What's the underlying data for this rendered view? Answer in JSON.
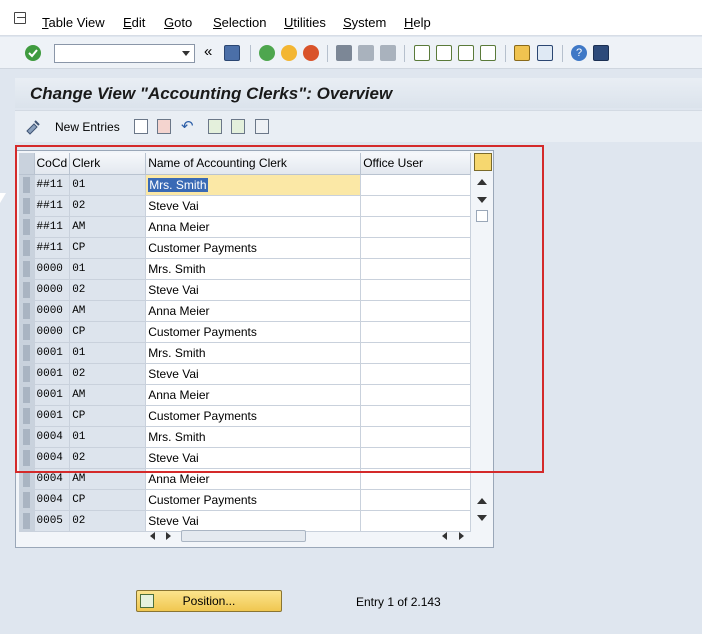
{
  "menubar": {
    "items": [
      "Table View",
      "Edit",
      "Goto",
      "Selection",
      "Utilities",
      "System",
      "Help"
    ]
  },
  "toolbar": {
    "command_field_value": "",
    "icons": [
      "enter-icon",
      "back-double-icon",
      "save-icon",
      "back-icon",
      "exit-icon",
      "cancel-icon",
      "print-icon",
      "find-icon",
      "find-next-icon",
      "first-page-icon",
      "previous-page-icon",
      "next-page-icon",
      "last-page-icon",
      "create-session-icon",
      "shortcut-icon",
      "help-icon",
      "layout-icon"
    ]
  },
  "page": {
    "title": "Change View \"Accounting Clerks\": Overview"
  },
  "app_toolbar": {
    "new_entries_label": "New Entries"
  },
  "table": {
    "columns": [
      "CoCd",
      "Clerk",
      "Name of Accounting Clerk",
      "Office User"
    ],
    "rows": [
      {
        "cocd": "##11",
        "clerk": "01",
        "name": "Mrs. Smith",
        "user": ""
      },
      {
        "cocd": "##11",
        "clerk": "02",
        "name": "Steve Vai",
        "user": ""
      },
      {
        "cocd": "##11",
        "clerk": "AM",
        "name": "Anna Meier",
        "user": ""
      },
      {
        "cocd": "##11",
        "clerk": "CP",
        "name": "Customer Payments",
        "user": ""
      },
      {
        "cocd": "0000",
        "clerk": "01",
        "name": "Mrs. Smith",
        "user": ""
      },
      {
        "cocd": "0000",
        "clerk": "02",
        "name": "Steve Vai",
        "user": ""
      },
      {
        "cocd": "0000",
        "clerk": "AM",
        "name": "Anna Meier",
        "user": ""
      },
      {
        "cocd": "0000",
        "clerk": "CP",
        "name": "Customer Payments",
        "user": ""
      },
      {
        "cocd": "0001",
        "clerk": "01",
        "name": "Mrs. Smith",
        "user": ""
      },
      {
        "cocd": "0001",
        "clerk": "02",
        "name": "Steve Vai",
        "user": ""
      },
      {
        "cocd": "0001",
        "clerk": "AM",
        "name": "Anna Meier",
        "user": ""
      },
      {
        "cocd": "0001",
        "clerk": "CP",
        "name": "Customer Payments",
        "user": ""
      },
      {
        "cocd": "0004",
        "clerk": "01",
        "name": "Mrs. Smith",
        "user": ""
      },
      {
        "cocd": "0004",
        "clerk": "02",
        "name": "Steve Vai",
        "user": ""
      },
      {
        "cocd": "0004",
        "clerk": "AM",
        "name": "Anna Meier",
        "user": ""
      },
      {
        "cocd": "0004",
        "clerk": "CP",
        "name": "Customer Payments",
        "user": ""
      },
      {
        "cocd": "0005",
        "clerk": "02",
        "name": "Steve Vai",
        "user": ""
      }
    ]
  },
  "footer": {
    "position_button_label": "Position...",
    "entry_text": "Entry 1 of 2.143"
  },
  "colors": {
    "highlight": "#d42a2a",
    "selected_cell": "#fbe8a6",
    "position_button": "#f0c750"
  }
}
